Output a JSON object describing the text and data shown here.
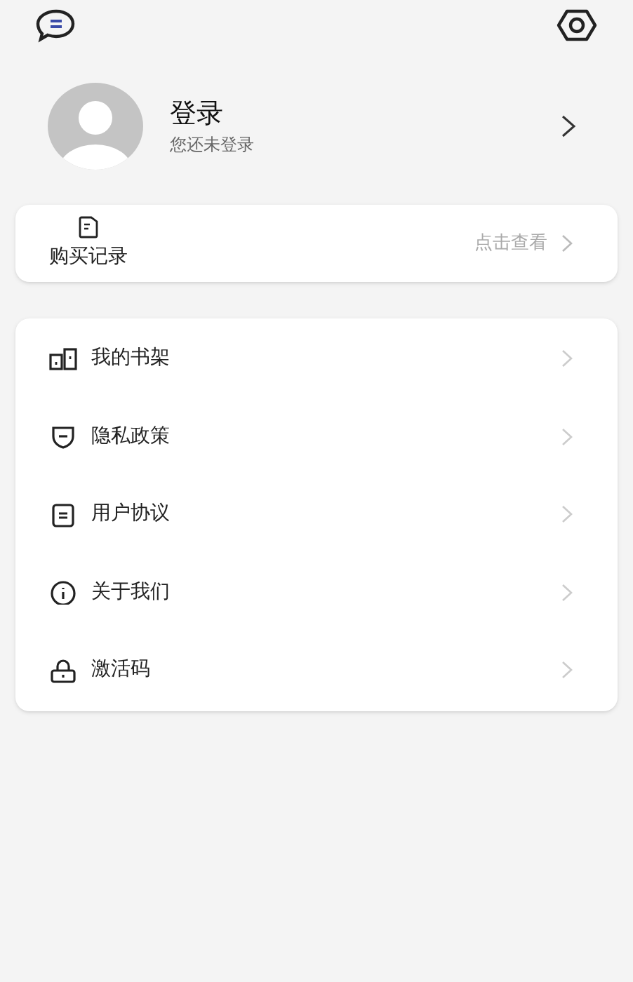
{
  "profile": {
    "title": "登录",
    "subtitle": "您还未登录"
  },
  "purchases": {
    "label": "购买记录",
    "action": "点击查看"
  },
  "menu": [
    {
      "kind": "bookshelf",
      "label": "我的书架"
    },
    {
      "kind": "shield",
      "label": "隐私政策"
    },
    {
      "kind": "document",
      "label": "用户协议"
    },
    {
      "kind": "info",
      "label": "关于我们"
    },
    {
      "kind": "lock",
      "label": "激活码"
    }
  ]
}
